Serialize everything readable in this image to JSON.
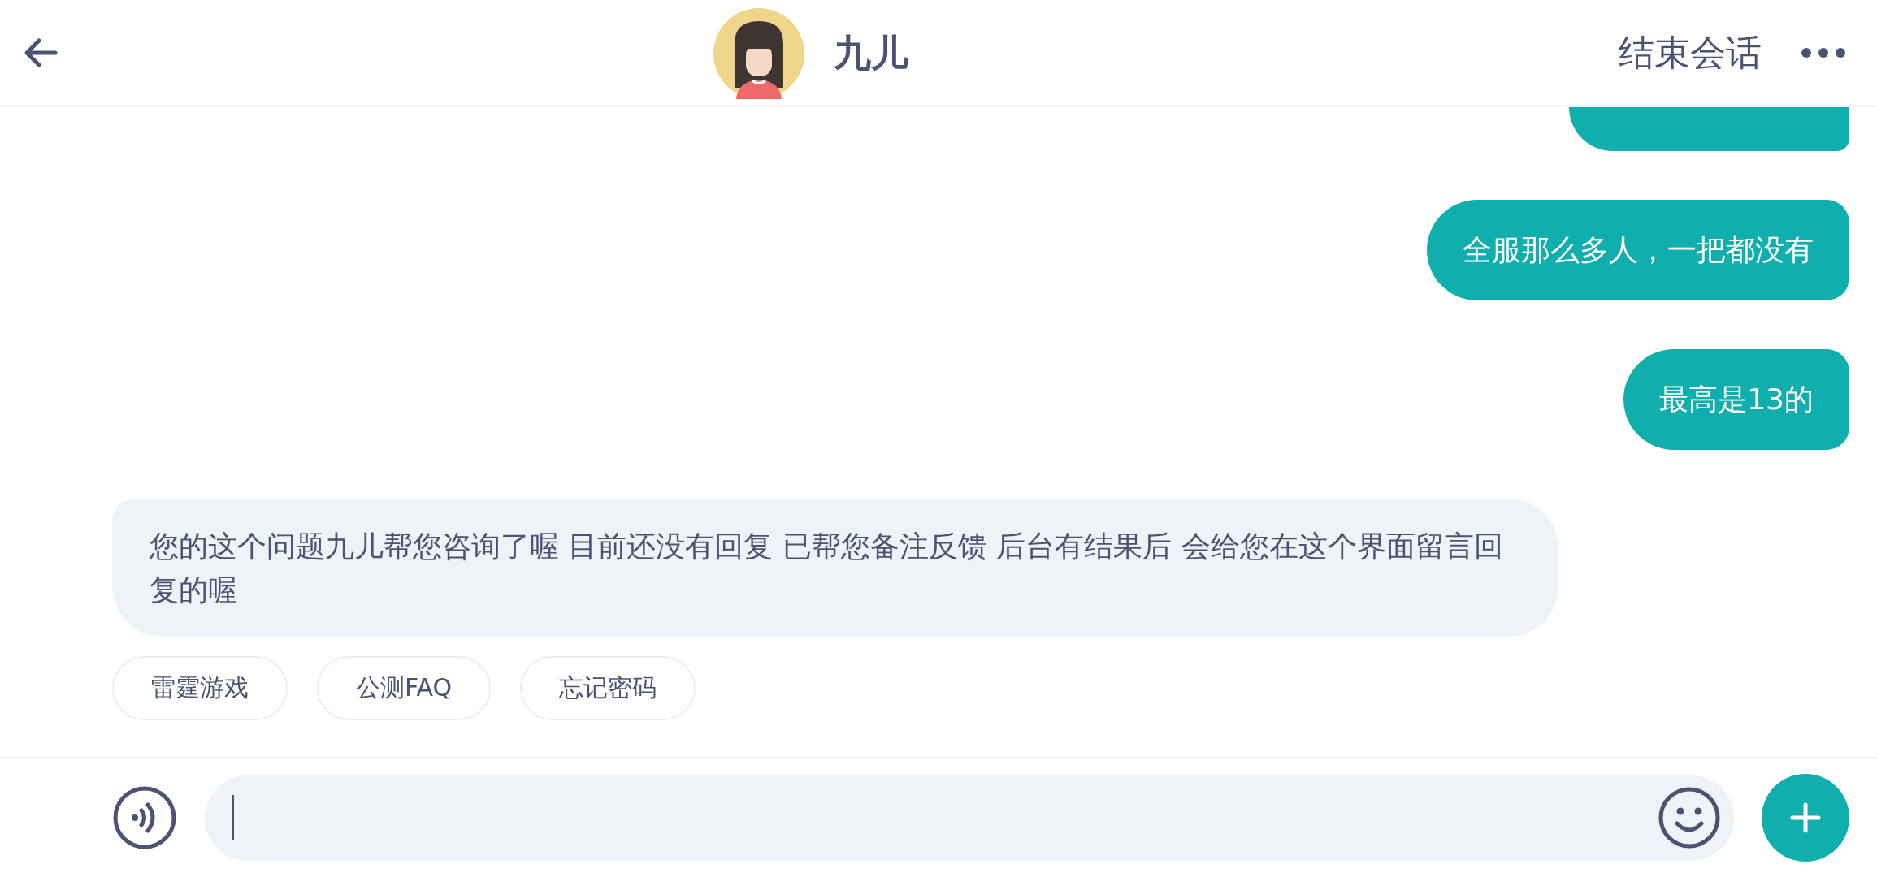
{
  "header": {
    "title": "九儿",
    "end_session": "结束会话"
  },
  "messages": [
    {
      "kind": "clipped"
    },
    {
      "kind": "sent",
      "text": "全服那么多人，一把都没有"
    },
    {
      "kind": "sent",
      "text": "最高是13的"
    },
    {
      "kind": "received",
      "text": "您的这个问题九儿帮您咨询了喔 目前还没有回复 已帮您备注反馈 后台有结果后 会给您在这个界面留言回复的喔"
    }
  ],
  "quick_replies": [
    "雷霆游戏",
    "公测FAQ",
    "忘记密码"
  ]
}
